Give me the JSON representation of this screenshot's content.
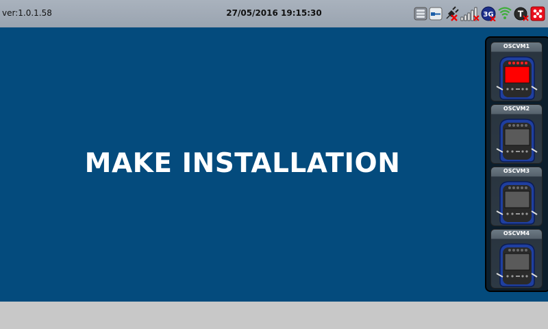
{
  "header": {
    "version": "ver:1.0.1.58",
    "datetime": "27/05/2016 19:15:30",
    "status_icons": [
      "database-icon",
      "connector-icon",
      "plug-disconnected-icon",
      "signal-bars-icon",
      "3g-icon",
      "wifi-icon",
      "t-badge-icon",
      "alarm-icon"
    ],
    "badge_3g": "3G",
    "badge_t": "T"
  },
  "main": {
    "message": "MAKE INSTALLATION"
  },
  "devices": [
    {
      "label": "OSCVM1",
      "screen_color": "#ff0000",
      "led_color": "#ff2020"
    },
    {
      "label": "OSCVM2",
      "screen_color": "#5a5a5a",
      "led_color": "#6a6a6a"
    },
    {
      "label": "OSCVM3",
      "screen_color": "#5a5a5a",
      "led_color": "#6a6a6a"
    },
    {
      "label": "OSCVM4",
      "screen_color": "#5a5a5a",
      "led_color": "#6a6a6a"
    }
  ],
  "colors": {
    "main_background": "#044b7d",
    "header_background": "#a9b2bd"
  }
}
